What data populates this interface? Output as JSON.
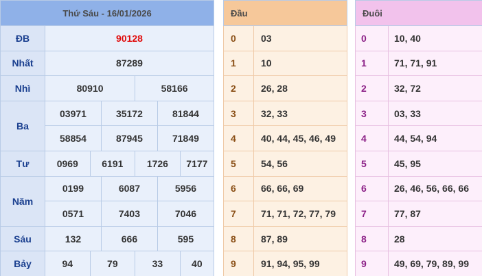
{
  "results": {
    "title": "Thứ Sáu - 16/01/2026",
    "rows": {
      "db": {
        "label": "ĐB",
        "values": [
          "90128"
        ]
      },
      "nhat": {
        "label": "Nhất",
        "values": [
          "87289"
        ]
      },
      "nhi": {
        "label": "Nhì",
        "values": [
          "80910",
          "58166"
        ]
      },
      "ba": {
        "label": "Ba",
        "values": [
          "03971",
          "35172",
          "81844",
          "58854",
          "87945",
          "71849"
        ]
      },
      "tu": {
        "label": "Tư",
        "values": [
          "0969",
          "6191",
          "1726",
          "7177"
        ]
      },
      "nam": {
        "label": "Năm",
        "values": [
          "0199",
          "6087",
          "5956",
          "0571",
          "7403",
          "7046"
        ]
      },
      "sau": {
        "label": "Sáu",
        "values": [
          "132",
          "666",
          "595"
        ]
      },
      "bay": {
        "label": "Bảy",
        "values": [
          "94",
          "79",
          "33",
          "40"
        ]
      }
    }
  },
  "head": {
    "title": "Đầu",
    "rows": [
      {
        "digit": "0",
        "numbers": "03"
      },
      {
        "digit": "1",
        "numbers": "10"
      },
      {
        "digit": "2",
        "numbers": "26, 28"
      },
      {
        "digit": "3",
        "numbers": "32, 33"
      },
      {
        "digit": "4",
        "numbers": "40, 44, 45, 46, 49"
      },
      {
        "digit": "5",
        "numbers": "54, 56"
      },
      {
        "digit": "6",
        "numbers": "66, 66, 69"
      },
      {
        "digit": "7",
        "numbers": "71, 71, 72, 77, 79"
      },
      {
        "digit": "8",
        "numbers": "87, 89"
      },
      {
        "digit": "9",
        "numbers": "91, 94, 95, 99"
      }
    ]
  },
  "tail": {
    "title": "Đuôi",
    "rows": [
      {
        "digit": "0",
        "numbers": "10, 40"
      },
      {
        "digit": "1",
        "numbers": "71, 71, 91"
      },
      {
        "digit": "2",
        "numbers": "32, 72"
      },
      {
        "digit": "3",
        "numbers": "03, 33"
      },
      {
        "digit": "4",
        "numbers": "44, 54, 94"
      },
      {
        "digit": "5",
        "numbers": "45, 95"
      },
      {
        "digit": "6",
        "numbers": "26, 46, 56, 66, 66"
      },
      {
        "digit": "7",
        "numbers": "77, 87"
      },
      {
        "digit": "8",
        "numbers": "28"
      },
      {
        "digit": "9",
        "numbers": "49, 69, 79, 89, 99"
      }
    ]
  },
  "colors": {
    "special_prize": "#e00b0b",
    "results_header": "#8fb1e8",
    "head_header": "#f6c89a",
    "tail_header": "#f2c2ec",
    "head_digit": "#8a4f16",
    "tail_digit": "#8b1f86"
  }
}
